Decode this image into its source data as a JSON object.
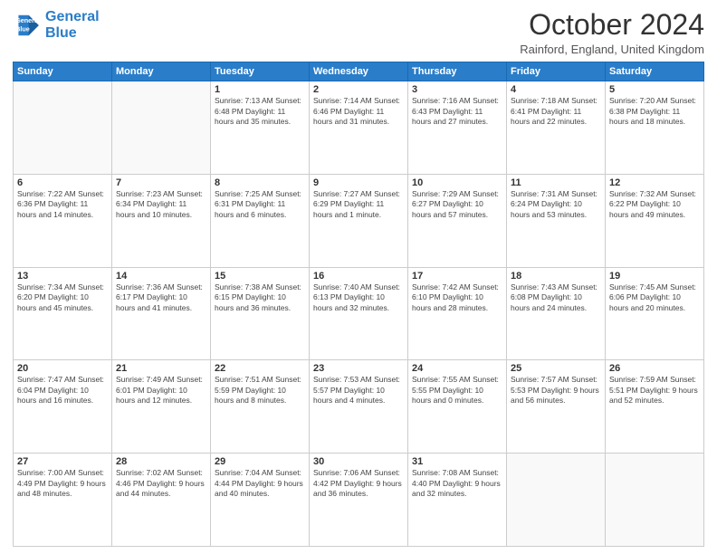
{
  "header": {
    "logo_line1": "General",
    "logo_line2": "Blue",
    "title": "October 2024",
    "location": "Rainford, England, United Kingdom"
  },
  "weekdays": [
    "Sunday",
    "Monday",
    "Tuesday",
    "Wednesday",
    "Thursday",
    "Friday",
    "Saturday"
  ],
  "weeks": [
    [
      {
        "day": "",
        "info": ""
      },
      {
        "day": "",
        "info": ""
      },
      {
        "day": "1",
        "info": "Sunrise: 7:13 AM\nSunset: 6:48 PM\nDaylight: 11 hours\nand 35 minutes."
      },
      {
        "day": "2",
        "info": "Sunrise: 7:14 AM\nSunset: 6:46 PM\nDaylight: 11 hours\nand 31 minutes."
      },
      {
        "day": "3",
        "info": "Sunrise: 7:16 AM\nSunset: 6:43 PM\nDaylight: 11 hours\nand 27 minutes."
      },
      {
        "day": "4",
        "info": "Sunrise: 7:18 AM\nSunset: 6:41 PM\nDaylight: 11 hours\nand 22 minutes."
      },
      {
        "day": "5",
        "info": "Sunrise: 7:20 AM\nSunset: 6:38 PM\nDaylight: 11 hours\nand 18 minutes."
      }
    ],
    [
      {
        "day": "6",
        "info": "Sunrise: 7:22 AM\nSunset: 6:36 PM\nDaylight: 11 hours\nand 14 minutes."
      },
      {
        "day": "7",
        "info": "Sunrise: 7:23 AM\nSunset: 6:34 PM\nDaylight: 11 hours\nand 10 minutes."
      },
      {
        "day": "8",
        "info": "Sunrise: 7:25 AM\nSunset: 6:31 PM\nDaylight: 11 hours\nand 6 minutes."
      },
      {
        "day": "9",
        "info": "Sunrise: 7:27 AM\nSunset: 6:29 PM\nDaylight: 11 hours\nand 1 minute."
      },
      {
        "day": "10",
        "info": "Sunrise: 7:29 AM\nSunset: 6:27 PM\nDaylight: 10 hours\nand 57 minutes."
      },
      {
        "day": "11",
        "info": "Sunrise: 7:31 AM\nSunset: 6:24 PM\nDaylight: 10 hours\nand 53 minutes."
      },
      {
        "day": "12",
        "info": "Sunrise: 7:32 AM\nSunset: 6:22 PM\nDaylight: 10 hours\nand 49 minutes."
      }
    ],
    [
      {
        "day": "13",
        "info": "Sunrise: 7:34 AM\nSunset: 6:20 PM\nDaylight: 10 hours\nand 45 minutes."
      },
      {
        "day": "14",
        "info": "Sunrise: 7:36 AM\nSunset: 6:17 PM\nDaylight: 10 hours\nand 41 minutes."
      },
      {
        "day": "15",
        "info": "Sunrise: 7:38 AM\nSunset: 6:15 PM\nDaylight: 10 hours\nand 36 minutes."
      },
      {
        "day": "16",
        "info": "Sunrise: 7:40 AM\nSunset: 6:13 PM\nDaylight: 10 hours\nand 32 minutes."
      },
      {
        "day": "17",
        "info": "Sunrise: 7:42 AM\nSunset: 6:10 PM\nDaylight: 10 hours\nand 28 minutes."
      },
      {
        "day": "18",
        "info": "Sunrise: 7:43 AM\nSunset: 6:08 PM\nDaylight: 10 hours\nand 24 minutes."
      },
      {
        "day": "19",
        "info": "Sunrise: 7:45 AM\nSunset: 6:06 PM\nDaylight: 10 hours\nand 20 minutes."
      }
    ],
    [
      {
        "day": "20",
        "info": "Sunrise: 7:47 AM\nSunset: 6:04 PM\nDaylight: 10 hours\nand 16 minutes."
      },
      {
        "day": "21",
        "info": "Sunrise: 7:49 AM\nSunset: 6:01 PM\nDaylight: 10 hours\nand 12 minutes."
      },
      {
        "day": "22",
        "info": "Sunrise: 7:51 AM\nSunset: 5:59 PM\nDaylight: 10 hours\nand 8 minutes."
      },
      {
        "day": "23",
        "info": "Sunrise: 7:53 AM\nSunset: 5:57 PM\nDaylight: 10 hours\nand 4 minutes."
      },
      {
        "day": "24",
        "info": "Sunrise: 7:55 AM\nSunset: 5:55 PM\nDaylight: 10 hours\nand 0 minutes."
      },
      {
        "day": "25",
        "info": "Sunrise: 7:57 AM\nSunset: 5:53 PM\nDaylight: 9 hours\nand 56 minutes."
      },
      {
        "day": "26",
        "info": "Sunrise: 7:59 AM\nSunset: 5:51 PM\nDaylight: 9 hours\nand 52 minutes."
      }
    ],
    [
      {
        "day": "27",
        "info": "Sunrise: 7:00 AM\nSunset: 4:49 PM\nDaylight: 9 hours\nand 48 minutes."
      },
      {
        "day": "28",
        "info": "Sunrise: 7:02 AM\nSunset: 4:46 PM\nDaylight: 9 hours\nand 44 minutes."
      },
      {
        "day": "29",
        "info": "Sunrise: 7:04 AM\nSunset: 4:44 PM\nDaylight: 9 hours\nand 40 minutes."
      },
      {
        "day": "30",
        "info": "Sunrise: 7:06 AM\nSunset: 4:42 PM\nDaylight: 9 hours\nand 36 minutes."
      },
      {
        "day": "31",
        "info": "Sunrise: 7:08 AM\nSunset: 4:40 PM\nDaylight: 9 hours\nand 32 minutes."
      },
      {
        "day": "",
        "info": ""
      },
      {
        "day": "",
        "info": ""
      }
    ]
  ]
}
